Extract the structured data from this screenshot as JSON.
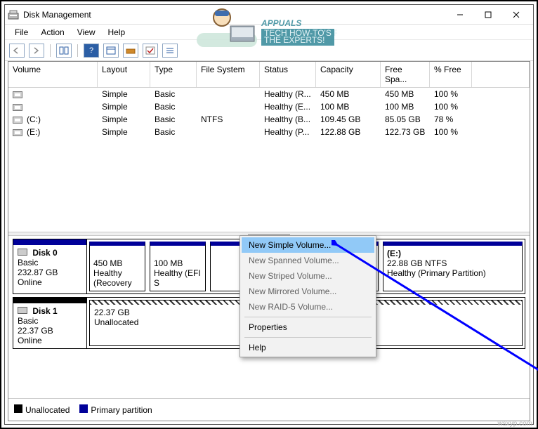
{
  "window": {
    "title": "Disk Management"
  },
  "menu": {
    "file": "File",
    "action": "Action",
    "view": "View",
    "help": "Help"
  },
  "columns": {
    "volume": "Volume",
    "layout": "Layout",
    "type": "Type",
    "fs": "File System",
    "status": "Status",
    "capacity": "Capacity",
    "free": "Free Spa...",
    "pct": "% Free"
  },
  "volumes": [
    {
      "name": "",
      "layout": "Simple",
      "type": "Basic",
      "fs": "",
      "status": "Healthy (R...",
      "cap": "450 MB",
      "free": "450 MB",
      "pct": "100 %"
    },
    {
      "name": "",
      "layout": "Simple",
      "type": "Basic",
      "fs": "",
      "status": "Healthy (E...",
      "cap": "100 MB",
      "free": "100 MB",
      "pct": "100 %"
    },
    {
      "name": "(C:)",
      "layout": "Simple",
      "type": "Basic",
      "fs": "NTFS",
      "status": "Healthy (B...",
      "cap": "109.45 GB",
      "free": "85.05 GB",
      "pct": "78 %"
    },
    {
      "name": "(E:)",
      "layout": "Simple",
      "type": "Basic",
      "fs": "",
      "status": "Healthy (P...",
      "cap": "122.88 GB",
      "free": "122.73 GB",
      "pct": "100 %"
    }
  ],
  "disks": {
    "d0": {
      "title": "Disk 0",
      "type": "Basic",
      "size": "232.87 GB",
      "state": "Online",
      "p0": {
        "size": "450 MB",
        "desc": "Healthy (Recovery"
      },
      "p1": {
        "size": "100 MB",
        "desc": "Healthy (EFI S"
      },
      "p2": {
        "name": "(E:)",
        "size": "22.88 GB NTFS",
        "desc": "Healthy (Primary Partition)"
      }
    },
    "d1": {
      "title": "Disk 1",
      "type": "Basic",
      "size": "22.37 GB",
      "state": "Online",
      "p0": {
        "size": "22.37 GB",
        "desc": "Unallocated"
      }
    }
  },
  "legend": {
    "unalloc": "Unallocated",
    "primary": "Primary partition"
  },
  "ctx": {
    "newSimple": "New Simple Volume...",
    "newSpanned": "New Spanned Volume...",
    "newStriped": "New Striped Volume...",
    "newMirrored": "New Mirrored Volume...",
    "newRaid": "New RAID-5 Volume...",
    "props": "Properties",
    "help": "Help"
  },
  "watermark": {
    "brand": "APPUALS",
    "tag1": "TECH HOW-TO'S FROM",
    "tag2": "THE EXPERTS!"
  },
  "credit": "wsxyp.com"
}
